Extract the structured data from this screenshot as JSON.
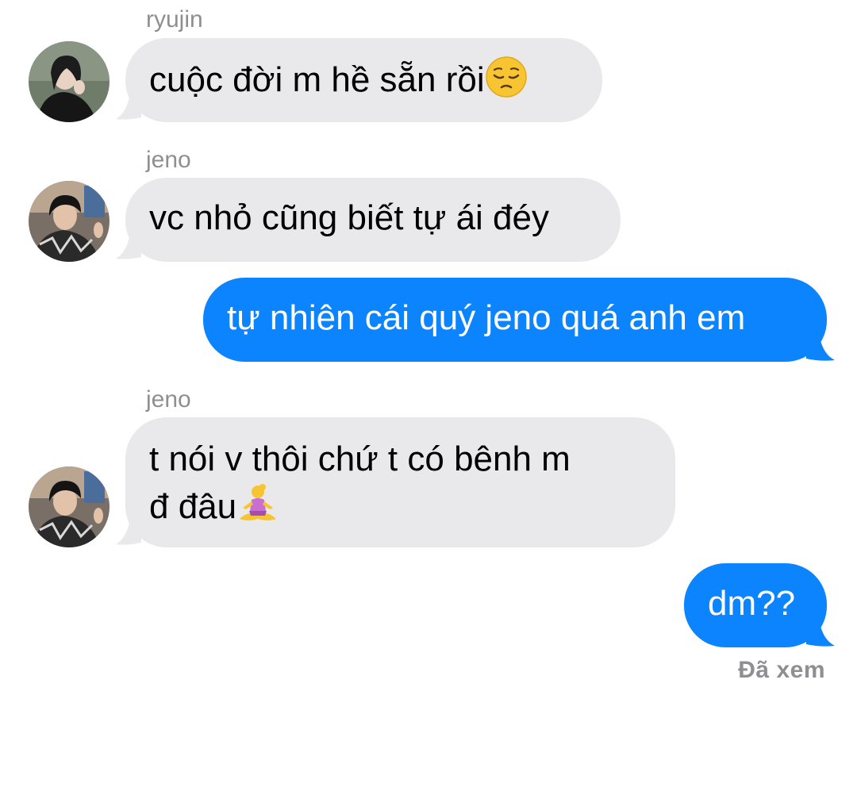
{
  "colors": {
    "incoming_bubble": "#e9e9eb",
    "outgoing_bubble": "#0b84fe",
    "sender_label": "#8e8e93"
  },
  "messages": [
    {
      "sender": "ryujin",
      "text": "cuộc đời m hề sẵn rồi",
      "emoji": "pensive-face-icon"
    },
    {
      "sender": "jeno",
      "text": "vc nhỏ cũng biết tự ái đéy"
    },
    {
      "outgoing": true,
      "text": "tự nhiên cái quý jeno quá anh em"
    },
    {
      "sender": "jeno",
      "line1": "t nói v thôi chứ t có bênh m",
      "line2": "đ đâu",
      "emoji": "person-in-lotus-position-icon"
    },
    {
      "outgoing": true,
      "text": "dm??"
    }
  ],
  "read_receipt": "Đã xem"
}
